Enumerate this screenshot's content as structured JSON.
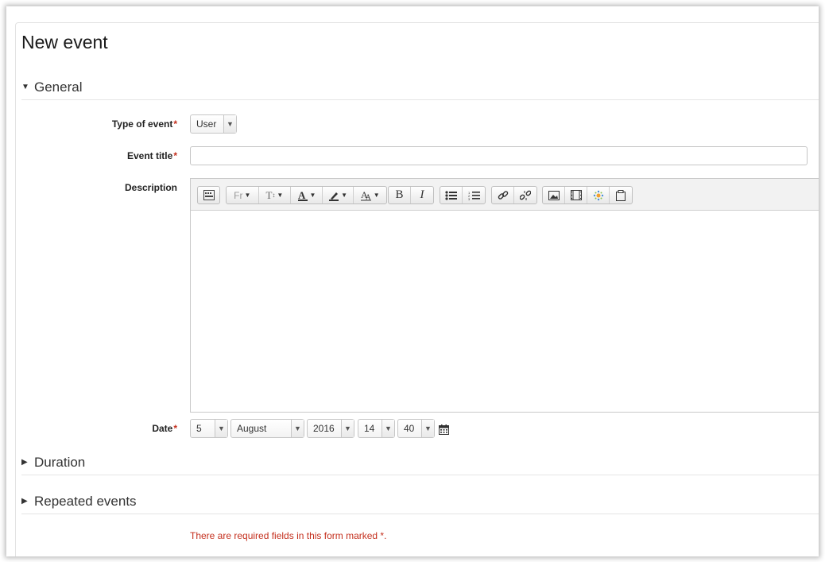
{
  "page": {
    "title": "New event"
  },
  "sections": {
    "general": "General",
    "duration": "Duration",
    "repeated": "Repeated events"
  },
  "form": {
    "type_label": "Type of event",
    "type_value": "User",
    "title_label": "Event title",
    "title_value": "",
    "description_label": "Description",
    "date_label": "Date",
    "required_marker": "*",
    "date": {
      "day": "5",
      "month": "August",
      "year": "2016",
      "hour": "14",
      "minute": "40"
    }
  },
  "toolbar": {
    "font_family": "Fr",
    "font_size": "T",
    "bold": "B",
    "italic": "I"
  },
  "icons": {
    "collapse": "triangle-down-icon",
    "expand": "triangle-right-icon",
    "select_arrow": "chevron-down-icon",
    "calendar": "calendar-icon"
  },
  "colors": {
    "required": "#c42f1d"
  },
  "footer": {
    "required_note": "There are required fields in this form marked *."
  }
}
